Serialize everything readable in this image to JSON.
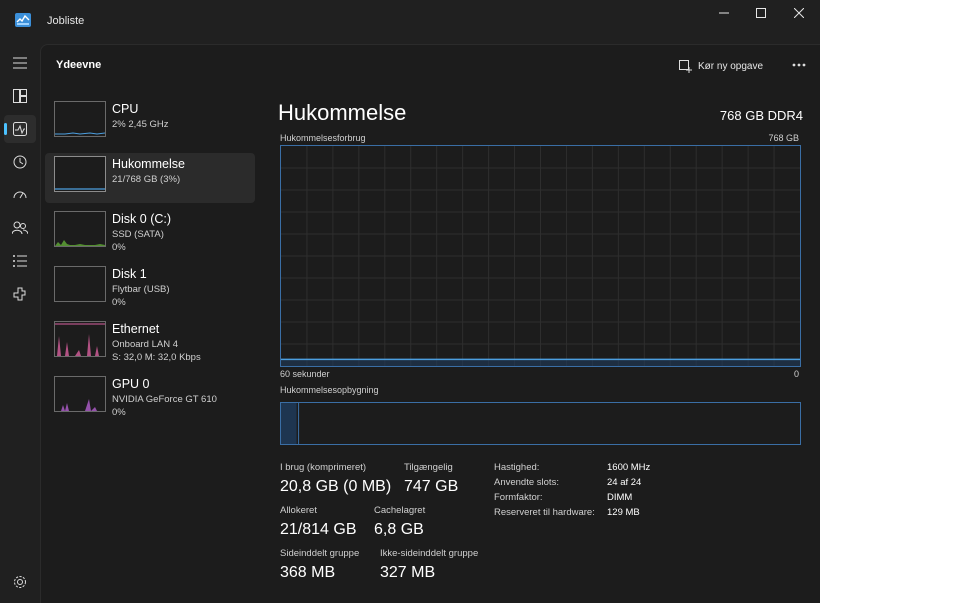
{
  "window": {
    "title": "Jobliste",
    "icon": "task-manager-icon"
  },
  "rail": {
    "items": [
      {
        "name": "menu-icon"
      },
      {
        "name": "processes-icon"
      },
      {
        "name": "performance-icon",
        "active": true
      },
      {
        "name": "app-history-icon"
      },
      {
        "name": "startup-apps-icon"
      },
      {
        "name": "users-icon"
      },
      {
        "name": "details-icon"
      },
      {
        "name": "services-icon"
      }
    ],
    "settings": "settings-gear-icon"
  },
  "header": {
    "title": "Ydeevne",
    "run_task": "Kør ny opgave"
  },
  "perf_list": [
    {
      "name": "CPU",
      "sub1": "2% 2,45 GHz",
      "sub2": "",
      "color": "#4c9fe0"
    },
    {
      "name": "Hukommelse",
      "sub1": "21/768 GB (3%)",
      "sub2": "",
      "color": "#4c9fe0",
      "selected": true
    },
    {
      "name": "Disk 0 (C:)",
      "sub1": "SSD (SATA)",
      "sub2": "0%",
      "color": "#6bbf3a"
    },
    {
      "name": "Disk 1",
      "sub1": "Flytbar (USB)",
      "sub2": "0%",
      "color": "#6bbf3a"
    },
    {
      "name": "Ethernet",
      "sub1": "Onboard LAN 4",
      "sub2": "S: 32,0 M: 32,0 Kbps",
      "color": "#d9609f"
    },
    {
      "name": "GPU 0",
      "sub1": "NVIDIA GeForce GT 610",
      "sub2": "0%",
      "color": "#b35fd0"
    }
  ],
  "memory": {
    "title": "Hukommelse",
    "type": "768 GB DDR4",
    "usage_label": "Hukommelsesforbrug",
    "usage_max": "768 GB",
    "time_left": "60 sekunder",
    "time_right": "0",
    "usage_fraction": 0.03,
    "composition_label": "Hukommelsesopbygning",
    "stats": {
      "in_use_label": "I brug (komprimeret)",
      "in_use": "20,8 GB (0 MB)",
      "available_label": "Tilgængelig",
      "available": "747 GB",
      "committed_label": "Allokeret",
      "committed": "21/814 GB",
      "cached_label": "Cachelagret",
      "cached": "6,8 GB",
      "paged_label": "Sideinddelt gruppe",
      "paged": "368 MB",
      "nonpaged_label": "Ikke-sideinddelt gruppe",
      "nonpaged": "327 MB"
    },
    "details": [
      {
        "key": "Hastighed:",
        "value": "1600 MHz"
      },
      {
        "key": "Anvendte slots:",
        "value": "24 af 24"
      },
      {
        "key": "Formfaktor:",
        "value": "DIMM"
      },
      {
        "key": "Reserveret til hardware:",
        "value": "129 MB"
      }
    ]
  },
  "colors": {
    "accent": "#4cc2ff",
    "graph_border": "#3a6ea5",
    "graph_line": "#4c9fe0"
  }
}
